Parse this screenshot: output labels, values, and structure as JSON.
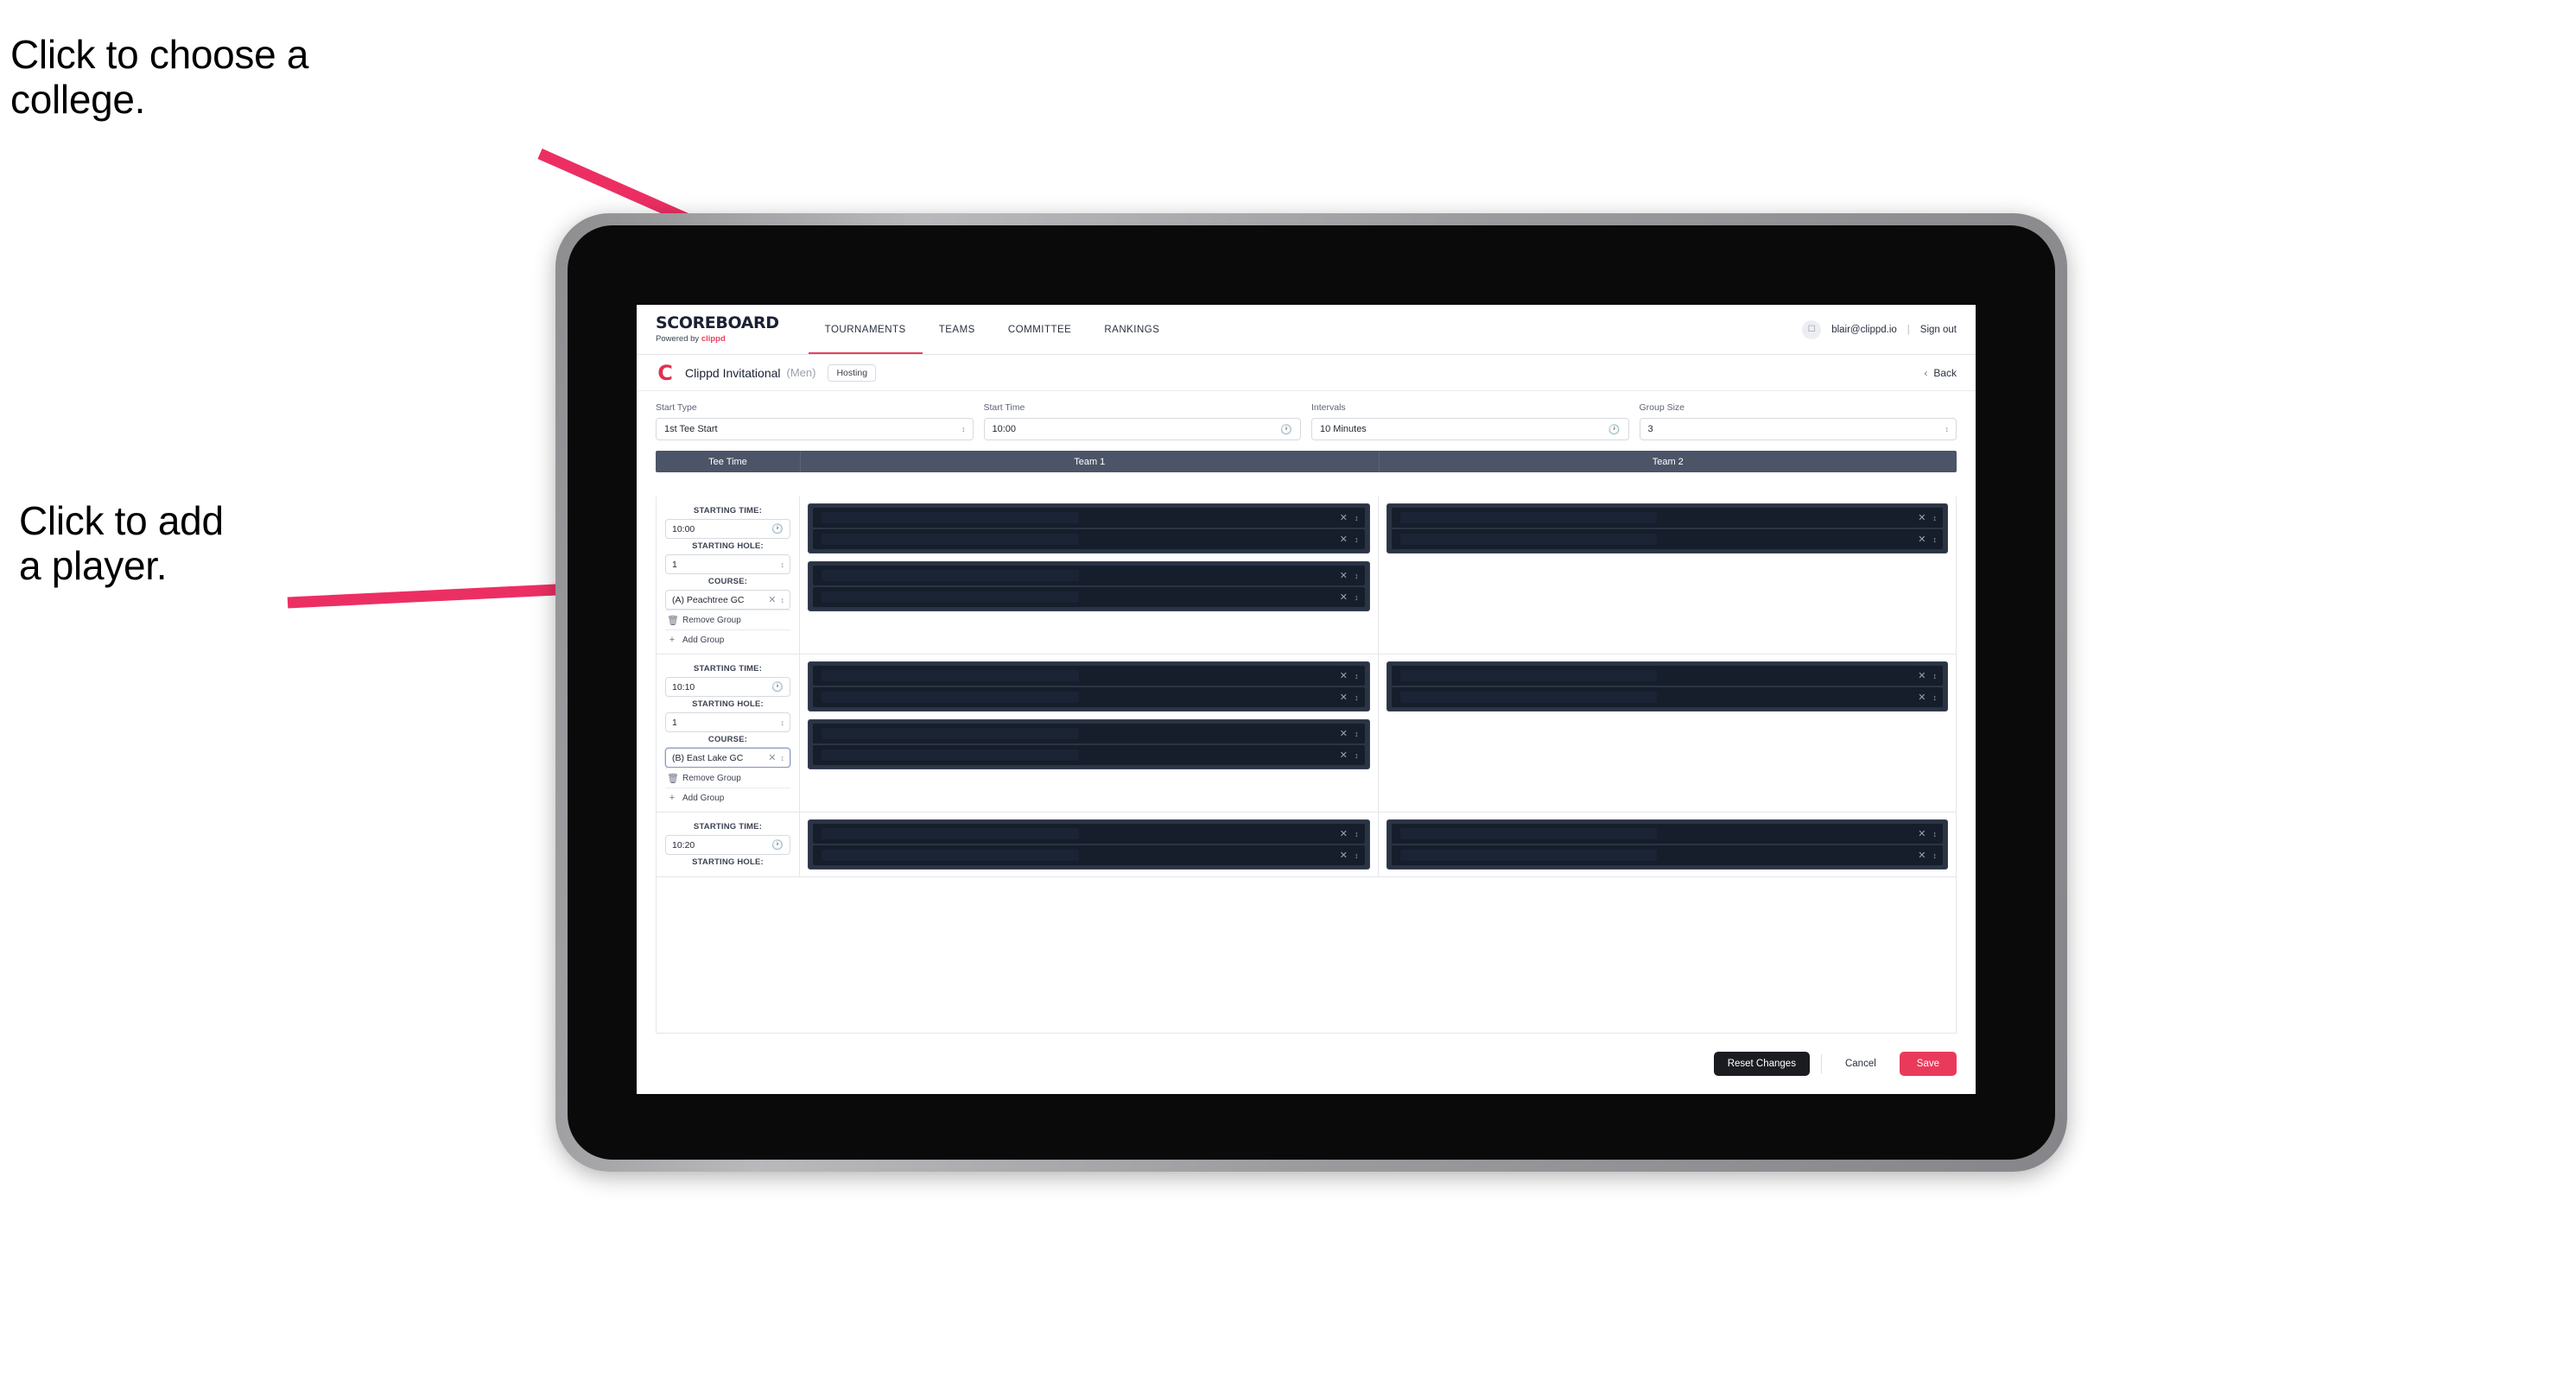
{
  "annotations": {
    "choose_college": "Click to choose a\ncollege.",
    "add_player": "Click to add\na player."
  },
  "colors": {
    "accent_pink": "#ea3a5c",
    "brand_red": "#e0304f",
    "table_header": "#4c5567",
    "slot_dark": "#161d2b",
    "group_dark": "#2b3443",
    "arrow_pink": "#ec2f63"
  },
  "app": {
    "brand": {
      "title": "SCOREBOARD",
      "powered_prefix": "Powered by ",
      "powered_brand": "clippd"
    },
    "nav": {
      "tabs": [
        {
          "label": "TOURNAMENTS",
          "active": true
        },
        {
          "label": "TEAMS",
          "active": false
        },
        {
          "label": "COMMITTEE",
          "active": false
        },
        {
          "label": "RANKINGS",
          "active": false
        }
      ],
      "account": {
        "avatar_icon": "user-avatar-icon",
        "email": "blair@clippd.io",
        "separator": "|",
        "sign_out": "Sign out"
      }
    },
    "tournament": {
      "logo_letter": "C",
      "name": "Clippd Invitational",
      "gender": "(Men)",
      "badge": "Hosting",
      "back_label": "Back",
      "back_icon": "chevron-left-icon"
    },
    "filters": [
      {
        "label": "Start Type",
        "value": "1st Tee Start",
        "icon": "chevron-updown-icon"
      },
      {
        "label": "Start Time",
        "value": "10:00",
        "icon": "clock-icon"
      },
      {
        "label": "Intervals",
        "value": "10 Minutes",
        "icon": "clock-icon"
      },
      {
        "label": "Group Size",
        "value": "3",
        "icon": "chevron-updown-icon"
      }
    ],
    "table": {
      "headers": {
        "tee_time": "Tee Time",
        "team1": "Team 1",
        "team2": "Team 2"
      },
      "labels": {
        "starting_time": "STARTING TIME:",
        "starting_hole": "STARTING HOLE:",
        "course": "COURSE:",
        "remove_group": "Remove Group",
        "add_group": "Add Group"
      },
      "rows": [
        {
          "starting_time": "10:00",
          "starting_hole": "1",
          "course": "(A) Peachtree GC",
          "course_focused": false,
          "team1_groups": [
            {
              "slots": 2
            },
            {
              "slots": 2
            }
          ],
          "team2_groups": [
            {
              "slots": 2
            }
          ]
        },
        {
          "starting_time": "10:10",
          "starting_hole": "1",
          "course": "(B) East Lake GC",
          "course_focused": true,
          "team1_groups": [
            {
              "slots": 2
            },
            {
              "slots": 2
            }
          ],
          "team2_groups": [
            {
              "slots": 2
            }
          ]
        },
        {
          "starting_time": "10:20",
          "starting_hole": "",
          "course": "",
          "course_focused": false,
          "team1_groups": [
            {
              "slots": 2
            }
          ],
          "team2_groups": [
            {
              "slots": 2
            }
          ]
        }
      ]
    },
    "footer": {
      "reset": "Reset Changes",
      "cancel": "Cancel",
      "save": "Save"
    }
  }
}
